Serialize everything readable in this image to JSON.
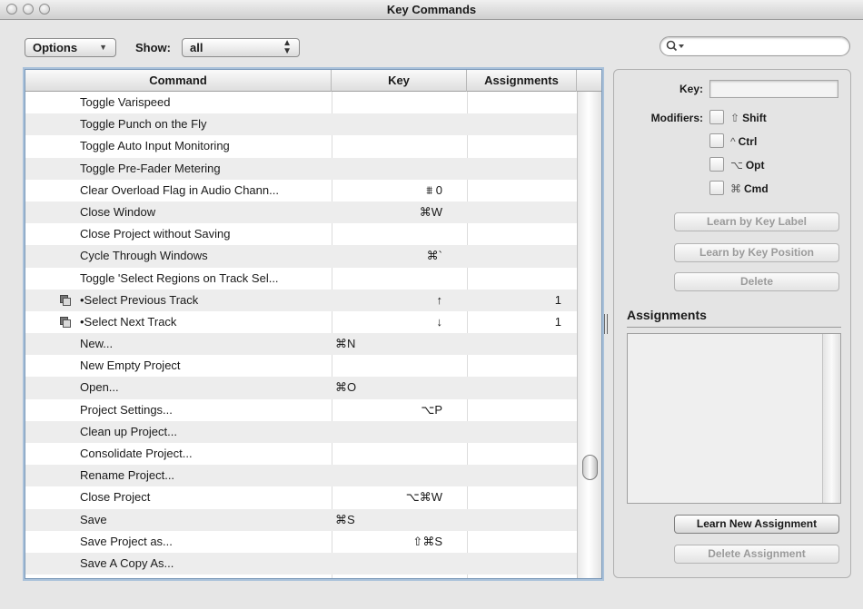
{
  "window": {
    "title": "Key Commands"
  },
  "toolbar": {
    "options_label": "Options",
    "show_label": "Show:",
    "show_value": "all",
    "search_placeholder": ""
  },
  "table": {
    "columns": [
      "Command",
      "Key",
      "Assignments"
    ],
    "rows": [
      {
        "command": "Toggle Varispeed",
        "key": "",
        "assignments": ""
      },
      {
        "command": "Toggle Punch on the Fly",
        "key": "",
        "assignments": ""
      },
      {
        "command": "Toggle Auto Input Monitoring",
        "key": "",
        "assignments": ""
      },
      {
        "command": "Toggle Pre-Fader Metering",
        "key": "",
        "assignments": ""
      },
      {
        "command": "Clear Overload Flag in Audio Chann...",
        "key": "⩩ 0",
        "assignments": ""
      },
      {
        "command": "Close Window",
        "key": "⌘W",
        "assignments": ""
      },
      {
        "command": "Close Project without Saving",
        "key": "",
        "assignments": ""
      },
      {
        "command": "Cycle Through Windows",
        "key": "⌘`",
        "assignments": ""
      },
      {
        "command": "Toggle 'Select Regions on Track Sel...",
        "key": "",
        "assignments": ""
      },
      {
        "command": "•Select Previous Track",
        "key": "↑",
        "assignments": "1",
        "icon": "multi-window-icon"
      },
      {
        "command": "•Select Next Track",
        "key": "↓",
        "assignments": "1",
        "icon": "multi-window-icon"
      },
      {
        "command": "New...",
        "key": "⌘N",
        "assignments": "",
        "key_align": "left"
      },
      {
        "command": "New Empty Project",
        "key": "",
        "assignments": ""
      },
      {
        "command": "Open...",
        "key": "⌘O",
        "assignments": "",
        "key_align": "left"
      },
      {
        "command": "Project Settings...",
        "key": "⌥P",
        "assignments": ""
      },
      {
        "command": "Clean up Project...",
        "key": "",
        "assignments": ""
      },
      {
        "command": "Consolidate Project...",
        "key": "",
        "assignments": ""
      },
      {
        "command": "Rename Project...",
        "key": "",
        "assignments": ""
      },
      {
        "command": "Close Project",
        "key": "⌥⌘W",
        "assignments": ""
      },
      {
        "command": "Save",
        "key": "⌘S",
        "assignments": "",
        "key_align": "left"
      },
      {
        "command": "Save Project as...",
        "key": "⇧⌘S",
        "assignments": ""
      },
      {
        "command": "Save A Copy As...",
        "key": "",
        "assignments": ""
      }
    ]
  },
  "panel": {
    "key_label": "Key:",
    "key_value": "",
    "modifiers_label": "Modifiers:",
    "modifiers": [
      {
        "symbol": "⇧",
        "label": "Shift"
      },
      {
        "symbol": "^",
        "label": "Ctrl"
      },
      {
        "symbol": "⌥",
        "label": "Opt"
      },
      {
        "symbol": "⌘",
        "label": "Cmd"
      }
    ],
    "learn_by_label": "Learn by Key Label",
    "learn_by_position": "Learn by Key Position",
    "delete_label": "Delete",
    "assignments_title": "Assignments",
    "learn_new_assignment": "Learn New Assignment",
    "delete_assignment": "Delete Assignment"
  }
}
